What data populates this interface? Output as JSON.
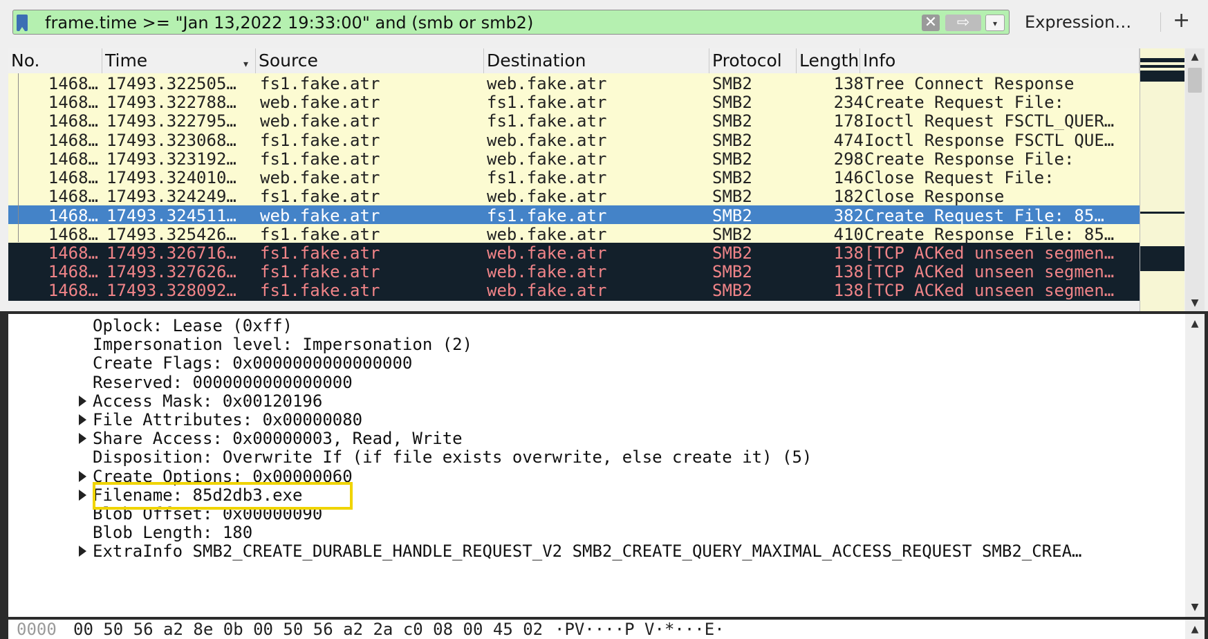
{
  "filter": {
    "text": "frame.time >= \"Jan 13,2022 19:33:00\" and (smb or smb2)",
    "clear_glyph": "✕",
    "apply_glyph": "⇨",
    "dropdown_glyph": "▾",
    "expression_label": "Expression…",
    "plus_label": "+"
  },
  "columns": [
    "No.",
    "Time",
    "Source",
    "Destination",
    "Protocol",
    "Length",
    "Info"
  ],
  "sort_glyph": "▾",
  "packets": [
    {
      "no": "1468…",
      "time": "17493.322505…",
      "src": "fs1.fake.atr",
      "dst": "web.fake.atr",
      "proto": "SMB2",
      "len": "138",
      "info": "Tree Connect Response"
    },
    {
      "no": "1468…",
      "time": "17493.322788…",
      "src": "web.fake.atr",
      "dst": "fs1.fake.atr",
      "proto": "SMB2",
      "len": "234",
      "info": "Create Request File:"
    },
    {
      "no": "1468…",
      "time": "17493.322795…",
      "src": "web.fake.atr",
      "dst": "fs1.fake.atr",
      "proto": "SMB2",
      "len": "178",
      "info": "Ioctl Request FSCTL_QUER…"
    },
    {
      "no": "1468…",
      "time": "17493.323068…",
      "src": "fs1.fake.atr",
      "dst": "web.fake.atr",
      "proto": "SMB2",
      "len": "474",
      "info": "Ioctl Response FSCTL_QUE…"
    },
    {
      "no": "1468…",
      "time": "17493.323192…",
      "src": "fs1.fake.atr",
      "dst": "web.fake.atr",
      "proto": "SMB2",
      "len": "298",
      "info": "Create Response File:"
    },
    {
      "no": "1468…",
      "time": "17493.324010…",
      "src": "web.fake.atr",
      "dst": "fs1.fake.atr",
      "proto": "SMB2",
      "len": "146",
      "info": "Close Request File:"
    },
    {
      "no": "1468…",
      "time": "17493.324249…",
      "src": "fs1.fake.atr",
      "dst": "web.fake.atr",
      "proto": "SMB2",
      "len": "182",
      "info": "Close Response"
    },
    {
      "no": "1468…",
      "time": "17493.324511…",
      "src": "web.fake.atr",
      "dst": "fs1.fake.atr",
      "proto": "SMB2",
      "len": "382",
      "info": "Create Request File: 85…"
    },
    {
      "no": "1468…",
      "time": "17493.325426…",
      "src": "fs1.fake.atr",
      "dst": "web.fake.atr",
      "proto": "SMB2",
      "len": "410",
      "info": "Create Response File: 85…"
    },
    {
      "no": "1468…",
      "time": "17493.326716…",
      "src": "fs1.fake.atr",
      "dst": "web.fake.atr",
      "proto": "SMB2",
      "len": "138",
      "info": "[TCP ACKed unseen segmen…"
    },
    {
      "no": "1468…",
      "time": "17493.327626…",
      "src": "fs1.fake.atr",
      "dst": "web.fake.atr",
      "proto": "SMB2",
      "len": "138",
      "info": "[TCP ACKed unseen segmen…"
    },
    {
      "no": "1468…",
      "time": "17493.328092…",
      "src": "fs1.fake.atr",
      "dst": "web.fake.atr",
      "proto": "SMB2",
      "len": "138",
      "info": "[TCP ACKed unseen segmen…"
    }
  ],
  "selected_row_index": 7,
  "row_colors": {
    "normal": "#fcfbd2",
    "selected": "#4483c8",
    "dark": "#13202b",
    "dark_text": "#f08488"
  },
  "details": {
    "lines": [
      {
        "text": "Oplock: Lease (0xff)",
        "expandable": false
      },
      {
        "text": "Impersonation level: Impersonation (2)",
        "expandable": false
      },
      {
        "text": "Create Flags: 0x0000000000000000",
        "expandable": false
      },
      {
        "text": "Reserved: 0000000000000000",
        "expandable": false
      },
      {
        "text": "Access Mask: 0x00120196",
        "expandable": true
      },
      {
        "text": "File Attributes: 0x00000080",
        "expandable": true
      },
      {
        "text": "Share Access: 0x00000003, Read, Write",
        "expandable": true
      },
      {
        "text": "Disposition: Overwrite If (if file exists overwrite, else create it) (5)",
        "expandable": false
      },
      {
        "text": "Create Options: 0x00000060",
        "expandable": true
      },
      {
        "text": "Filename: 85d2db3.exe",
        "expandable": true
      },
      {
        "text": "Blob Offset: 0x00000090",
        "expandable": false
      },
      {
        "text": "Blob Length: 180",
        "expandable": false
      },
      {
        "text": "ExtraInfo SMB2_CREATE_DURABLE_HANDLE_REQUEST_V2 SMB2_CREATE_QUERY_MAXIMAL_ACCESS_REQUEST SMB2_CREA…",
        "expandable": true
      }
    ],
    "highlight_color": "#f0d400"
  },
  "bytes": {
    "offset": "0000",
    "hex": "00 50 56 a2 8e 0b 00 50  56 a2 2a c0 08 00 45 02",
    "ascii": "·PV····P V·*···E·"
  }
}
